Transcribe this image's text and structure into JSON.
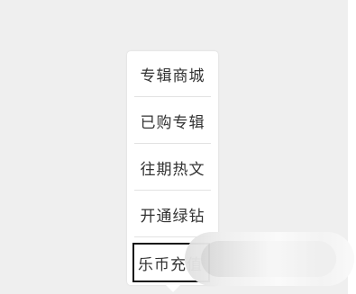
{
  "menu": {
    "items": [
      {
        "label": "专辑商城"
      },
      {
        "label": "已购专辑"
      },
      {
        "label": "往期热文"
      },
      {
        "label": "开通绿钻"
      },
      {
        "label": "乐币充值"
      }
    ]
  }
}
